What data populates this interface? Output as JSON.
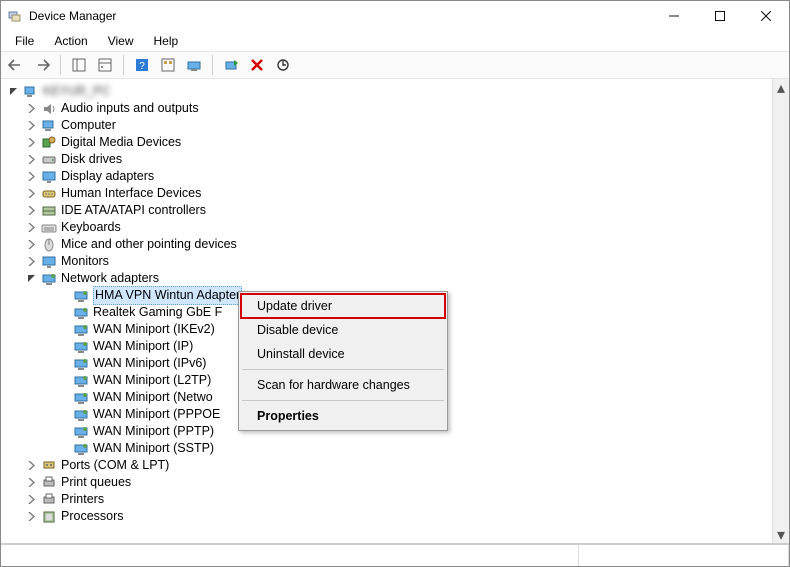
{
  "title": "Device Manager",
  "menubar": [
    "File",
    "Action",
    "View",
    "Help"
  ],
  "root_pc_name": "KEYUR_PC",
  "categories": [
    {
      "label": "Audio inputs and outputs",
      "icon": "audio",
      "expanded": false
    },
    {
      "label": "Computer",
      "icon": "computer",
      "expanded": false
    },
    {
      "label": "Digital Media Devices",
      "icon": "media",
      "expanded": false
    },
    {
      "label": "Disk drives",
      "icon": "disk",
      "expanded": false
    },
    {
      "label": "Display adapters",
      "icon": "display",
      "expanded": false
    },
    {
      "label": "Human Interface Devices",
      "icon": "hid",
      "expanded": false
    },
    {
      "label": "IDE ATA/ATAPI controllers",
      "icon": "ide",
      "expanded": false
    },
    {
      "label": "Keyboards",
      "icon": "keyboard",
      "expanded": false
    },
    {
      "label": "Mice and other pointing devices",
      "icon": "mouse",
      "expanded": false
    },
    {
      "label": "Monitors",
      "icon": "monitor",
      "expanded": false
    },
    {
      "label": "Network adapters",
      "icon": "network",
      "expanded": true,
      "children": [
        {
          "label": "HMA VPN Wintun Adapter",
          "icon": "network",
          "selected": true
        },
        {
          "label": "Realtek Gaming GbE F",
          "icon": "network",
          "truncated": true
        },
        {
          "label": "WAN Miniport (IKEv2)",
          "icon": "network"
        },
        {
          "label": "WAN Miniport (IP)",
          "icon": "network"
        },
        {
          "label": "WAN Miniport (IPv6)",
          "icon": "network"
        },
        {
          "label": "WAN Miniport (L2TP)",
          "icon": "network"
        },
        {
          "label": "WAN Miniport (Netwo",
          "icon": "network",
          "truncated": true
        },
        {
          "label": "WAN Miniport (PPPOE",
          "icon": "network",
          "truncated": true
        },
        {
          "label": "WAN Miniport (PPTP)",
          "icon": "network"
        },
        {
          "label": "WAN Miniport (SSTP)",
          "icon": "network"
        }
      ]
    },
    {
      "label": "Ports (COM & LPT)",
      "icon": "port",
      "expanded": false
    },
    {
      "label": "Print queues",
      "icon": "print",
      "expanded": false
    },
    {
      "label": "Printers",
      "icon": "print",
      "expanded": false
    },
    {
      "label": "Processors",
      "icon": "cpu",
      "expanded": false,
      "cutoff": true
    }
  ],
  "context_menu": [
    "Update driver",
    "Disable device",
    "Uninstall device",
    "Scan for hardware changes",
    "Properties"
  ],
  "context_menu_anchor": {
    "category_index": 10,
    "child_index": 0
  },
  "colors": {
    "highlight_red": "#d40000",
    "selection_blue": "#d0e7ff"
  }
}
